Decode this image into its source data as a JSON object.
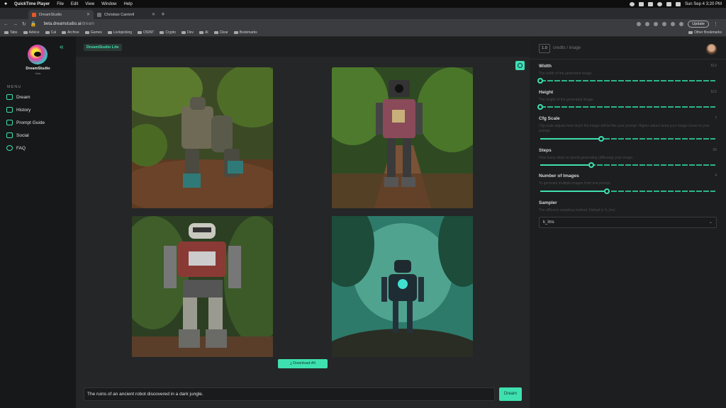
{
  "menubar": {
    "app": "QuickTime Player",
    "items": [
      "File",
      "Edit",
      "View",
      "Window",
      "Help"
    ],
    "clock": "Sun Sep 4  3:20 PM"
  },
  "browser": {
    "tabs": [
      {
        "title": "DreamStudio",
        "active": true
      },
      {
        "title": "Christian Cantrell",
        "active": false
      }
    ],
    "url_host": "beta.dreamstudio.ai",
    "url_path": "/dream",
    "update_label": "Update",
    "bookmarks": [
      "Tabs",
      "Advice",
      "Cal",
      "Archive",
      "Games",
      "Lockpicking",
      "OSINT",
      "Crypto",
      "Dev",
      "AI",
      "Clear",
      "Bookmarks"
    ],
    "other_bookmarks": "Other Bookmarks"
  },
  "sidebar": {
    "brand": "DreamStudio",
    "brand_sub": "beta",
    "menu_label": "MENU",
    "items": [
      {
        "label": "Dream",
        "icon": "palette-icon"
      },
      {
        "label": "History",
        "icon": "image-icon"
      },
      {
        "label": "Prompt Guide",
        "icon": "book-icon"
      },
      {
        "label": "Social",
        "icon": "discord-icon"
      },
      {
        "label": "FAQ",
        "icon": "question-icon"
      }
    ]
  },
  "main": {
    "lite_tag": "DreamStudio Lite",
    "download_label": "Download All",
    "prompt": "The ruins of an ancient robot discovered in a dark jungle.",
    "dream_label": "Dream"
  },
  "panel": {
    "credits_value": "1.0",
    "credits_label": "credits / image",
    "controls": [
      {
        "title": "Width",
        "desc": "The width of the generated image.",
        "value": "512",
        "fraction": 0.0
      },
      {
        "title": "Height",
        "desc": "The height of the generated image.",
        "value": "512",
        "fraction": 0.0
      },
      {
        "title": "Cfg Scale",
        "desc": "Cfg scale adjusts how much the image will be like your prompt. Higher values keep your image closer to your prompt.",
        "value": "7",
        "fraction": 0.35
      },
      {
        "title": "Steps",
        "desc": "How many steps to spend generating (diffusing) your image.",
        "value": "50",
        "fraction": 0.29
      },
      {
        "title": "Number of Images",
        "desc": "To generate multiple images from one prompt.",
        "value": "4",
        "fraction": 0.38
      }
    ],
    "sampler_title": "Sampler",
    "sampler_desc": "The diffusion sampling method. Default is 'k_lms'.",
    "sampler_value": "k_lms"
  },
  "colors": {
    "accent": "#3fe0b0",
    "background": "#1b1c1e"
  }
}
